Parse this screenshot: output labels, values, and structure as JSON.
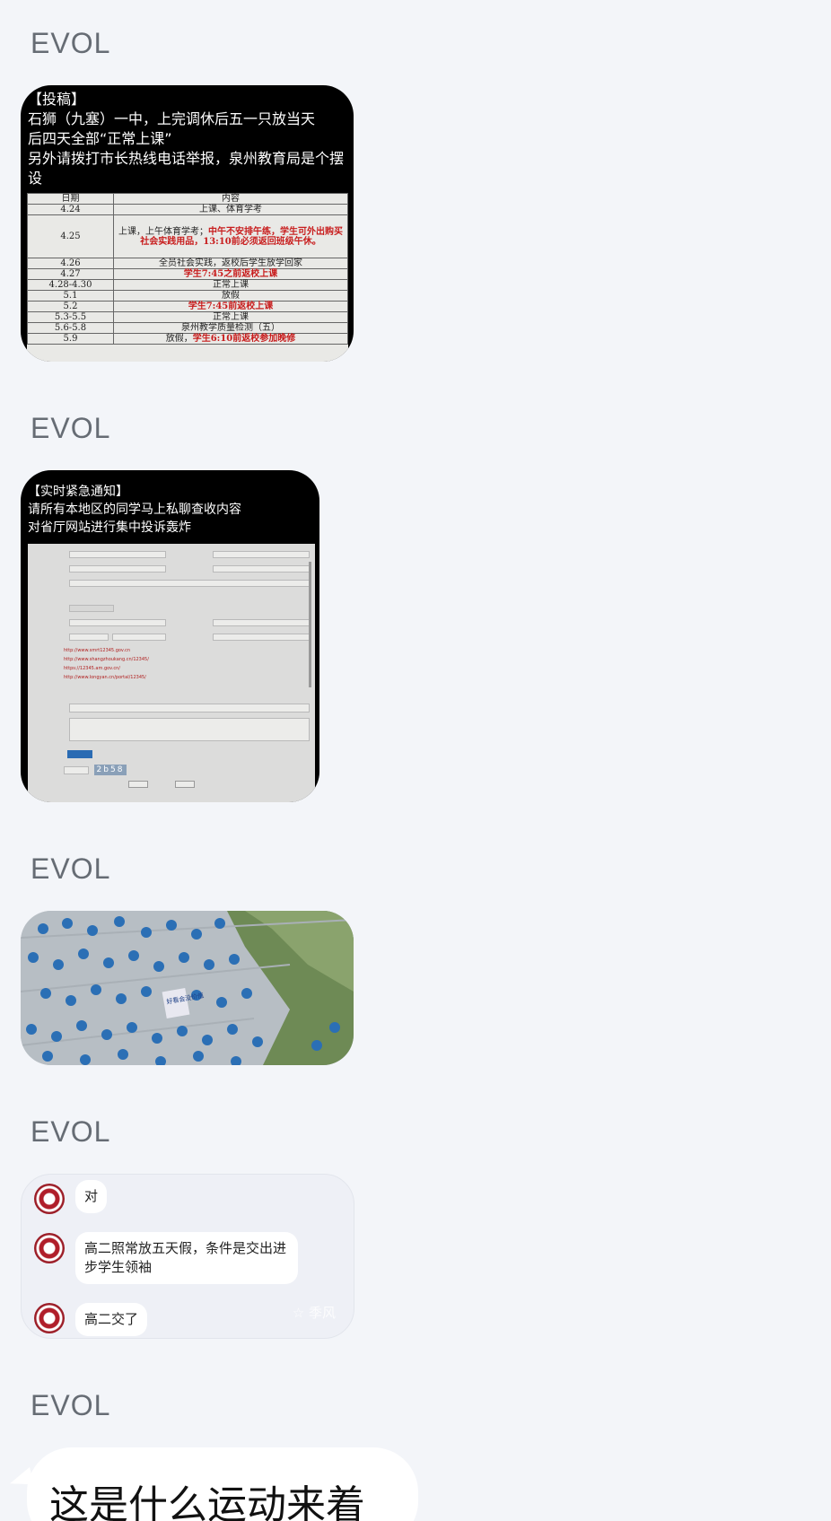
{
  "messages": [
    {
      "sender": "EVOL",
      "type": "image",
      "header_lines": [
        "【投稿】",
        "石狮（九塞）一中，上完调休后五一只放当天",
        "后四天全部“正常上课”",
        "另外请拨打市长热线电话举报，泉州教育局是个摆",
        "设"
      ],
      "schedule": {
        "headers": [
          "日期",
          "内容"
        ],
        "rows": [
          {
            "date": "4.24",
            "plain": "上课、体育学考",
            "red": ""
          },
          {
            "date": "4.25",
            "plain": "上课，上午体育学考；",
            "red": "中午不安排午练，学生可外出购买社会实践用品，13:10前必须返回班级午休。"
          },
          {
            "date": "4.26",
            "plain": "全员社会实践，返校后学生放学回家",
            "red": ""
          },
          {
            "date": "4.27",
            "plain": "",
            "red": "学生7:45之前返校上课"
          },
          {
            "date": "4.28-4.30",
            "plain": "正常上课",
            "red": ""
          },
          {
            "date": "5.1",
            "plain": "放假",
            "red": ""
          },
          {
            "date": "5.2",
            "plain": "",
            "red": "学生7:45前返校上课"
          },
          {
            "date": "5.3-5.5",
            "plain": "正常上课",
            "red": ""
          },
          {
            "date": "5.6-5.8",
            "plain": "泉州教学质量检测（五）",
            "red": ""
          },
          {
            "date": "5.9",
            "plain": "放假，",
            "red": "学生6:10前返校参加晚修"
          }
        ]
      }
    },
    {
      "sender": "EVOL",
      "type": "image",
      "header_lines": [
        "【实时紧急通知】",
        "请所有本地区的同学马上私聊查收内容",
        "对省厅网站进行集中投诉轰炸"
      ],
      "form_links": [
        "http://www.smrt12345.gov.cn",
        "http://www.shangzhoukang.cn/12345/",
        "https://12345.am.gov.cn/",
        "http://www.longyan.cn/portal/12345/"
      ],
      "form_code": "2b58"
    },
    {
      "sender": "EVOL",
      "type": "photo",
      "sign_text": "好看会没价值"
    },
    {
      "sender": "EVOL",
      "type": "chat-screenshot",
      "chat": [
        {
          "text": "对"
        },
        {
          "text": "高二照常放五天假，条件是交出进步学生领袖"
        },
        {
          "text": "高二交了"
        }
      ],
      "watermark": "季风"
    },
    {
      "sender": "EVOL",
      "type": "text",
      "text": "这是什么运动来着"
    }
  ]
}
